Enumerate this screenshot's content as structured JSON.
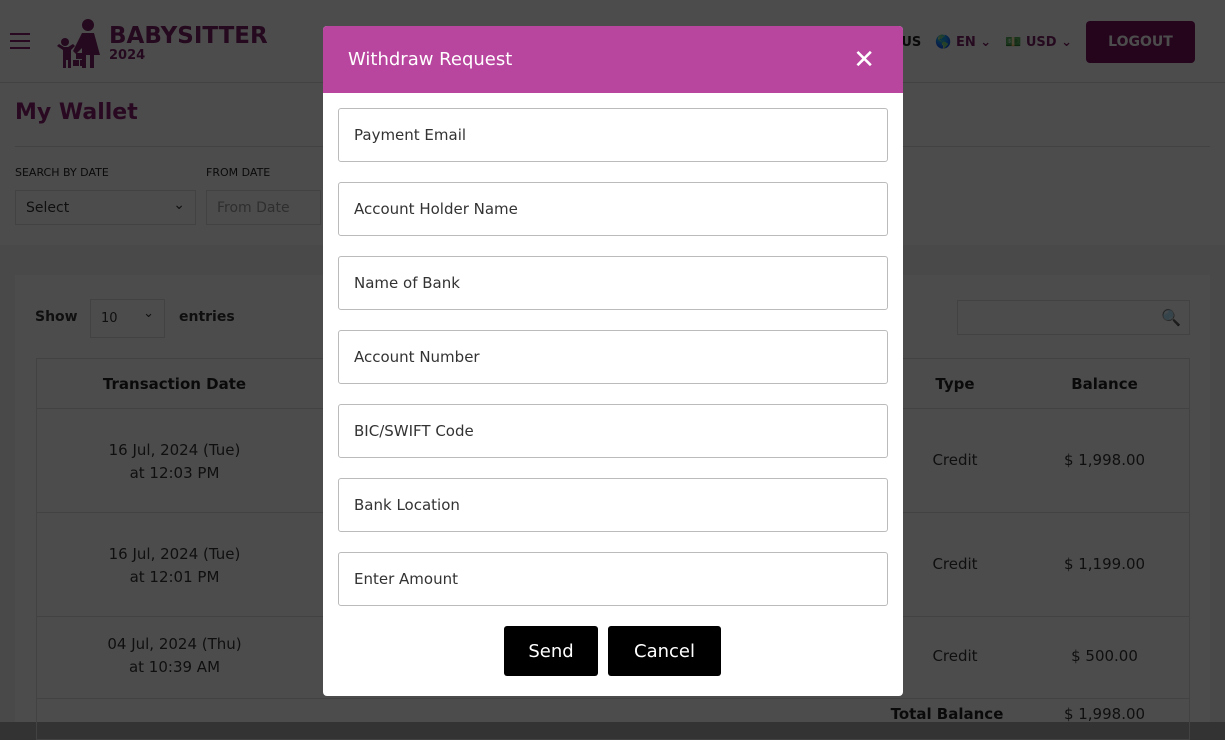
{
  "header": {
    "logo_title": "BABYSITTER",
    "logo_year": "2024",
    "us": "US",
    "language": "EN",
    "currency": "USD",
    "logout": "LOGOUT"
  },
  "page": {
    "title": "My Wallet",
    "filters": {
      "search_by_date_label": "SEARCH BY DATE",
      "search_by_date_value": "Select",
      "from_date_label": "FROM DATE",
      "from_date_placeholder": "From Date"
    }
  },
  "table": {
    "show": "Show",
    "page_size": "10",
    "entries": "entries",
    "columns": [
      "Transaction Date",
      "Type",
      "Balance"
    ],
    "rows": [
      {
        "date": "16 Jul, 2024 (Tue)",
        "time": "at 12:03 PM",
        "type": "Credit",
        "balance": "$ 1,998.00"
      },
      {
        "date": "16 Jul, 2024 (Tue)",
        "time": "at 12:01 PM",
        "type": "Credit",
        "balance": "$ 1,199.00"
      },
      {
        "date": "04 Jul, 2024 (Thu)",
        "time": "at 10:39 AM",
        "type": "Credit",
        "balance": "$ 500.00"
      }
    ],
    "total_label": "Total Balance",
    "total_value": "$ 1,998.00"
  },
  "modal": {
    "title": "Withdraw Request",
    "fields": [
      "Payment Email",
      "Account Holder Name",
      "Name of Bank",
      "Account Number",
      "BIC/SWIFT Code",
      "Bank Location",
      "Enter Amount"
    ],
    "send": "Send",
    "cancel": "Cancel",
    "header_color": "#b8459e"
  }
}
